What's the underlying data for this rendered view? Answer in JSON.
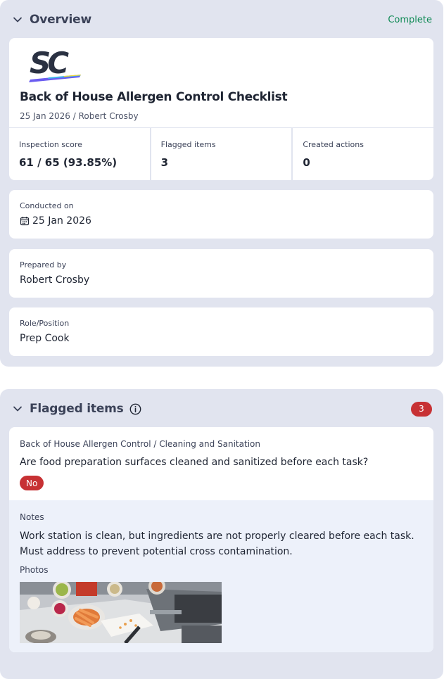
{
  "overview": {
    "title": "Overview",
    "status": "Complete",
    "doc_title": "Back of House Allergen Control Checklist",
    "doc_subtitle": "25 Jan 2026 / Robert Crosby",
    "stats": [
      {
        "label": "Inspection score",
        "value": "61 / 65 (93.85%)"
      },
      {
        "label": "Flagged items",
        "value": "3"
      },
      {
        "label": "Created actions",
        "value": "0"
      }
    ],
    "fields": [
      {
        "label": "Conducted on",
        "value": "25 Jan 2026",
        "icon": "calendar-icon"
      },
      {
        "label": "Prepared by",
        "value": "Robert Crosby"
      },
      {
        "label": "Role/Position",
        "value": "Prep Cook"
      }
    ]
  },
  "flagged": {
    "title": "Flagged items",
    "count": "3",
    "items": [
      {
        "path": "Back of House Allergen Control / Cleaning and Sanitation",
        "question": "Are food preparation surfaces cleaned and sanitized before each task?",
        "response": "No",
        "notes_label": "Notes",
        "notes": "Work station is clean, but ingredients are not properly cleared before each task. Must address to prevent potential cross contamination.",
        "photos_label": "Photos"
      }
    ]
  },
  "colors": {
    "section_bg": "#e1e4ef",
    "complete": "#0f8a55",
    "badge_red": "#c73134",
    "notes_bg": "#edf1fa"
  },
  "icons": {
    "collapse": "chevron-down-icon",
    "info": "info-icon",
    "calendar": "calendar-icon",
    "logo": "safetyculture-logo"
  }
}
